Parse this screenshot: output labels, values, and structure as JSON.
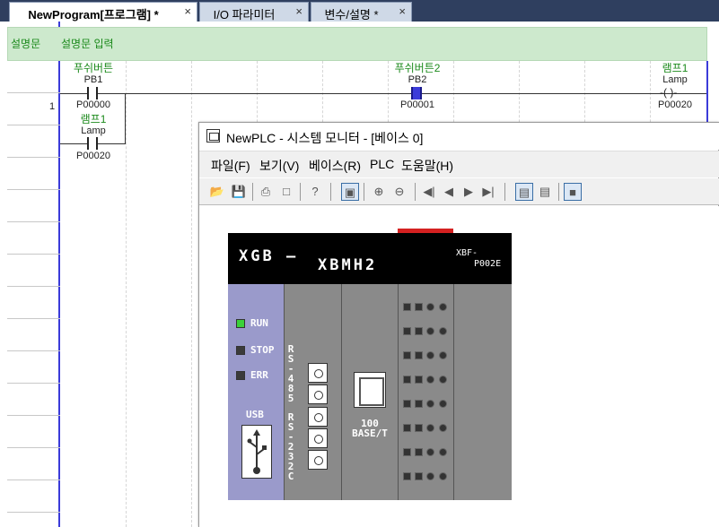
{
  "tabs": [
    {
      "label": "NewProgram[프로그램] *",
      "close": "×"
    },
    {
      "label": "I/O 파라미터",
      "close": "×"
    },
    {
      "label": "변수/설명 *",
      "close": "×"
    }
  ],
  "ladder": {
    "comment_label": "설명문",
    "comment_text": "설명문 입력",
    "rung_number": "1",
    "contact_pb1": {
      "comment": "푸쉬버튼",
      "name": "PB1",
      "address": "P00000"
    },
    "contact_pb2": {
      "comment": "푸쉬버튼2",
      "name": "PB2",
      "address": "P00001"
    },
    "coil_lamp": {
      "comment": "램프1",
      "name": "Lamp",
      "address": "P00020",
      "symbol": "-( )-"
    },
    "contact_lamp": {
      "comment": "램프1",
      "name": "Lamp",
      "address": "P00020"
    }
  },
  "monitor": {
    "title": "NewPLC - 시스템 모니터 - [베이스 0]",
    "menu": [
      {
        "label": "파일(F)"
      },
      {
        "label": "보기(V)"
      },
      {
        "label": "베이스(R)"
      },
      {
        "label": "PLC"
      },
      {
        "label": "도움말(H)"
      }
    ],
    "plc": {
      "brand": "XGB —",
      "model": "XBMH2",
      "module_line1": "XBF-",
      "module_line2": "P002E",
      "status_leds": [
        {
          "label": "RUN",
          "color": "#3ad13a"
        },
        {
          "label": "STOP",
          "color": "#3a3a3a"
        },
        {
          "label": "ERR",
          "color": "#3a3a3a"
        }
      ],
      "usb_label": "USB",
      "rs485_label": "RS-485",
      "rs232_label": "RS-232C",
      "ethernet_line1": "100",
      "ethernet_line2": "BASE/T"
    }
  },
  "colors": {
    "tabbar": "#2f3f5f",
    "rail": "#3b3bd9",
    "comment_bg": "#cde9cd",
    "comment_text": "#1c8a1c",
    "plc_purple": "#9a9acb",
    "plc_gray": "#8a8a8a"
  },
  "icons": [
    "open-icon",
    "save-icon",
    "print-icon",
    "print-preview-icon",
    "help-icon",
    "monitor-icon",
    "zoom-in-icon",
    "zoom-out-icon",
    "first-icon",
    "prev-icon",
    "next-icon",
    "last-icon",
    "comm-icon",
    "comm2-icon",
    "screen-icon"
  ]
}
